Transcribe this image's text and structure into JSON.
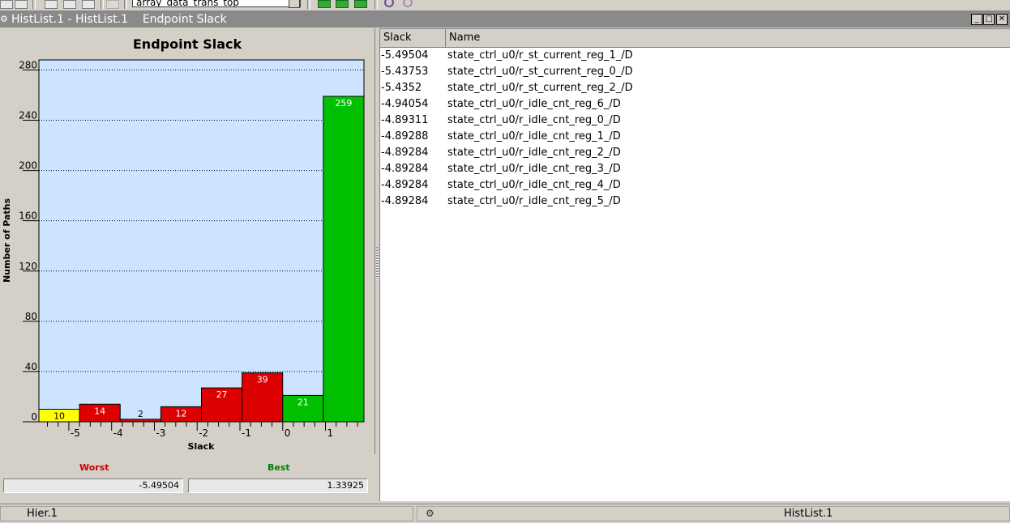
{
  "toolbar": {
    "design_combo_value": "array_data_trans_top",
    "icons": [
      "open-icon",
      "add-icon",
      "schematic-icon",
      "schematic-icon",
      "schematic-icon",
      "disabled-icon",
      "green-block-icon",
      "green-block-icon",
      "green-block-icon",
      "zoom-icon",
      "zoom-icon"
    ]
  },
  "window": {
    "title": "HistList.1 - HistList.1    Endpoint Slack",
    "minimize_icon": "minimize-icon",
    "maximize_icon": "maximize-icon",
    "close_icon": "close-icon"
  },
  "chart_data": {
    "type": "bar",
    "title": "Endpoint Slack",
    "xlabel": "Slack",
    "ylabel": "Number of Paths",
    "ylim": [
      0,
      288
    ],
    "xlim": [
      -5.7,
      1.9
    ],
    "yticks": [
      0,
      40,
      80,
      120,
      160,
      200,
      240,
      280
    ],
    "xtick_labels": [
      "-5",
      "-4",
      "-3",
      "-2",
      "-1",
      "0",
      "1"
    ],
    "grid": true,
    "bins": [
      {
        "start": -5.7,
        "end": -4.75,
        "value": 10,
        "color": "#ffff00"
      },
      {
        "start": -4.75,
        "end": -3.8,
        "value": 14,
        "color": "#dd0000"
      },
      {
        "start": -3.8,
        "end": -2.85,
        "value": 2,
        "color": "#dd0000"
      },
      {
        "start": -2.85,
        "end": -1.9,
        "value": 12,
        "color": "#dd0000"
      },
      {
        "start": -1.9,
        "end": -0.95,
        "value": 27,
        "color": "#dd0000"
      },
      {
        "start": -0.95,
        "end": 0.0,
        "value": 39,
        "color": "#dd0000"
      },
      {
        "start": 0.0,
        "end": 0.95,
        "value": 21,
        "color": "#00c000"
      },
      {
        "start": 0.95,
        "end": 1.9,
        "value": 259,
        "color": "#00c000"
      }
    ],
    "plot_background": "#cce4ff"
  },
  "summary": {
    "worst_label": "Worst",
    "worst_value": "-5.49504",
    "worst_color": "#cc0000",
    "best_label": "Best",
    "best_value": "1.33925",
    "best_color": "#008000"
  },
  "list": {
    "columns": [
      "Slack",
      "Name"
    ],
    "rows": [
      {
        "slack": "-5.49504",
        "name": "state_ctrl_u0/r_st_current_reg_1_/D"
      },
      {
        "slack": "-5.43753",
        "name": "state_ctrl_u0/r_st_current_reg_0_/D"
      },
      {
        "slack": "-5.4352",
        "name": "state_ctrl_u0/r_st_current_reg_2_/D"
      },
      {
        "slack": "-4.94054",
        "name": "state_ctrl_u0/r_idle_cnt_reg_6_/D"
      },
      {
        "slack": "-4.89311",
        "name": "state_ctrl_u0/r_idle_cnt_reg_0_/D"
      },
      {
        "slack": "-4.89288",
        "name": "state_ctrl_u0/r_idle_cnt_reg_1_/D"
      },
      {
        "slack": "-4.89284",
        "name": "state_ctrl_u0/r_idle_cnt_reg_2_/D"
      },
      {
        "slack": "-4.89284",
        "name": "state_ctrl_u0/r_idle_cnt_reg_3_/D"
      },
      {
        "slack": "-4.89284",
        "name": "state_ctrl_u0/r_idle_cnt_reg_4_/D"
      },
      {
        "slack": "-4.89284",
        "name": "state_ctrl_u0/r_idle_cnt_reg_5_/D"
      }
    ]
  },
  "statusbar": {
    "left_text": "Hier.1",
    "right_icon": "histogram-status-icon",
    "right_text": "HistList.1"
  }
}
